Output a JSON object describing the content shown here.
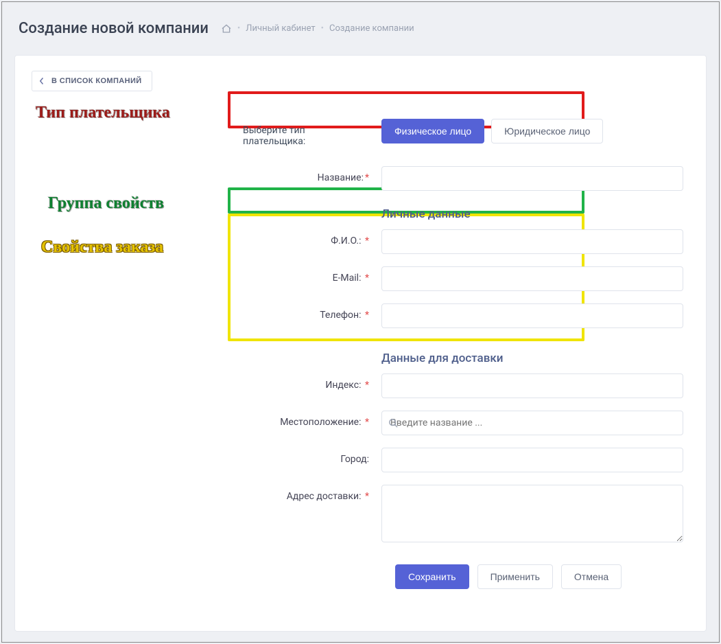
{
  "header": {
    "title": "Создание новой компании",
    "breadcrumbs": [
      "Личный кабинет",
      "Создание компании"
    ]
  },
  "back_button": "В СПИСОК КОМПАНИЙ",
  "callouts": {
    "payer_type": "Тип плательщика",
    "prop_group": "Группа свойств",
    "order_props": "Свойства заказа"
  },
  "payer": {
    "label": "Выберите тип плательщика:",
    "option_individual": "Физическое лицо",
    "option_legal": "Юридическое лицо"
  },
  "fields": {
    "name_label": "Название:",
    "fio_label": "Ф.И.О.:",
    "email_label": "E-Mail:",
    "phone_label": "Телефон:",
    "index_label": "Индекс:",
    "location_label": "Местоположение:",
    "location_placeholder": "Введите название ...",
    "city_label": "Город:",
    "delivery_addr_label": "Адрес доставки:"
  },
  "sections": {
    "personal": "Личные данные",
    "delivery": "Данные для доставки"
  },
  "footer": {
    "save": "Сохранить",
    "apply": "Применить",
    "cancel": "Отмена"
  }
}
